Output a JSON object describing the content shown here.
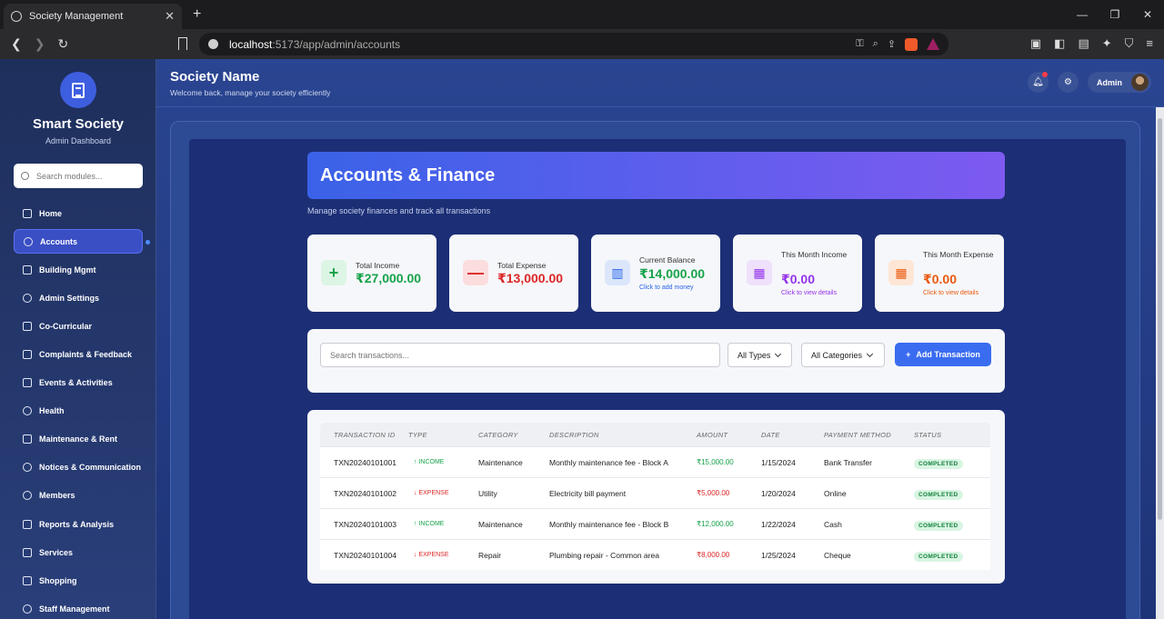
{
  "browser": {
    "tab_title": "Society Management",
    "url_host": "localhost",
    "url_path": ":5173/app/admin/accounts"
  },
  "sidebar": {
    "brand": "Smart Society",
    "subtitle": "Admin Dashboard",
    "search_placeholder": "Search modules...",
    "items": [
      {
        "label": "Home",
        "icon": "home-icon"
      },
      {
        "label": "Accounts",
        "icon": "user-circle-icon"
      },
      {
        "label": "Building Mgmt",
        "icon": "wrench-icon"
      },
      {
        "label": "Admin Settings",
        "icon": "gear-icon"
      },
      {
        "label": "Co-Curricular",
        "icon": "book-icon"
      },
      {
        "label": "Complaints & Feedback",
        "icon": "warning-icon"
      },
      {
        "label": "Events & Activities",
        "icon": "activity-icon"
      },
      {
        "label": "Health",
        "icon": "heart-icon"
      },
      {
        "label": "Maintenance & Rent",
        "icon": "tool-icon"
      },
      {
        "label": "Notices & Communication",
        "icon": "bell-icon"
      },
      {
        "label": "Members",
        "icon": "users-icon"
      },
      {
        "label": "Reports & Analysis",
        "icon": "chart-icon"
      },
      {
        "label": "Services",
        "icon": "document-icon"
      },
      {
        "label": "Shopping",
        "icon": "cart-icon"
      },
      {
        "label": "Staff Management",
        "icon": "shield-icon"
      }
    ]
  },
  "header": {
    "title": "Society Name",
    "subtitle": "Welcome back, manage your society efficiently",
    "admin_label": "Admin"
  },
  "page": {
    "title": "Accounts & Finance",
    "subtitle": "Manage society finances and track all transactions"
  },
  "cards": [
    {
      "label": "Total Income",
      "value": "₹27,000.00",
      "hint": "",
      "icon": "plus-icon",
      "color": "#16a34a",
      "bg": "#dcf5e4"
    },
    {
      "label": "Total Expense",
      "value": "₹13,000.00",
      "hint": "",
      "icon": "minus-icon",
      "color": "#dc2626",
      "bg": "#fbdddd"
    },
    {
      "label": "Current Balance",
      "value": "₹14,000.00",
      "hint": "Click to add money",
      "icon": "bar-chart-icon",
      "color": "#16a34a",
      "bg": "#dbe6fb"
    },
    {
      "label": "This Month Income",
      "value": "₹0.00",
      "hint": "Click to view details",
      "icon": "calendar-icon",
      "color": "#9333ea",
      "bg": "#efe0fb"
    },
    {
      "label": "This Month Expense",
      "value": "₹0.00",
      "hint": "Click to view details",
      "icon": "calendar-icon",
      "color": "#ea580c",
      "bg": "#fde6d6"
    }
  ],
  "filters": {
    "search_placeholder": "Search transactions...",
    "type_select": "All Types",
    "category_select": "All Categories",
    "add_button": "Add Transaction"
  },
  "table": {
    "headers": [
      "TRANSACTION ID",
      "TYPE",
      "CATEGORY",
      "DESCRIPTION",
      "AMOUNT",
      "DATE",
      "PAYMENT METHOD",
      "STATUS"
    ],
    "rows": [
      {
        "id": "TXN20240101001",
        "type": "↑ INCOME",
        "kind": "in",
        "category": "Maintenance",
        "description": "Monthly maintenance fee - Block A",
        "amount": "₹15,000.00",
        "date": "1/15/2024",
        "method": "Bank Transfer",
        "status": "COMPLETED"
      },
      {
        "id": "TXN20240101002",
        "type": "↓ EXPENSE",
        "kind": "ex",
        "category": "Utility",
        "description": "Electricity bill payment",
        "amount": "₹5,000.00",
        "date": "1/20/2024",
        "method": "Online",
        "status": "COMPLETED"
      },
      {
        "id": "TXN20240101003",
        "type": "↑ INCOME",
        "kind": "in",
        "category": "Maintenance",
        "description": "Monthly maintenance fee - Block B",
        "amount": "₹12,000.00",
        "date": "1/22/2024",
        "method": "Cash",
        "status": "COMPLETED"
      },
      {
        "id": "TXN20240101004",
        "type": "↓ EXPENSE",
        "kind": "ex",
        "category": "Repair",
        "description": "Plumbing repair - Common area",
        "amount": "₹8,000.00",
        "date": "1/25/2024",
        "method": "Cheque",
        "status": "COMPLETED"
      }
    ]
  }
}
